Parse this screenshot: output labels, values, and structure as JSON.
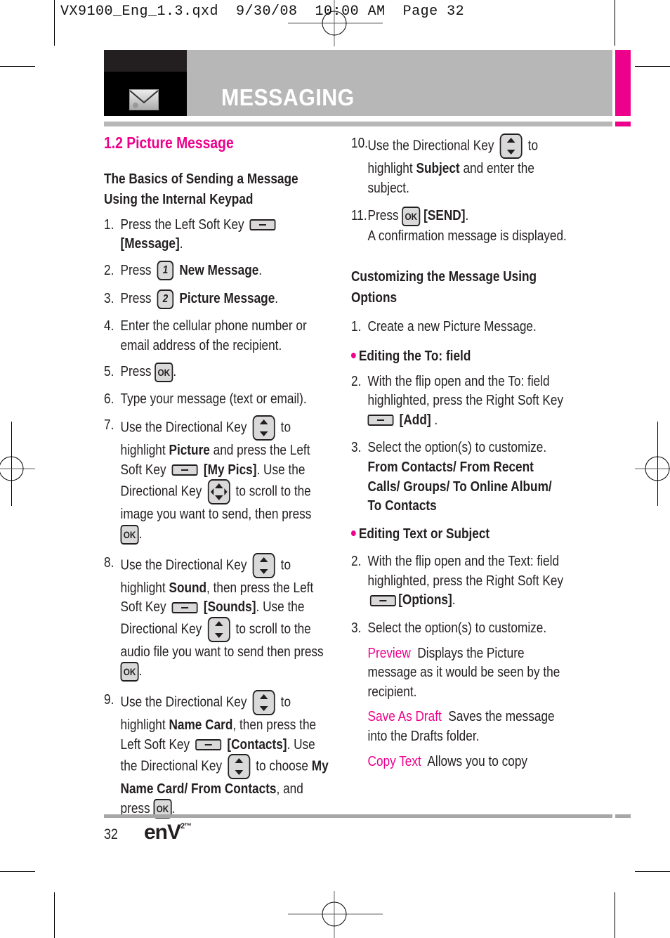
{
  "slug": "VX9100_Eng_1.3.qxd  9/30/08  10:00 AM  Page 32",
  "header": {
    "icon": "envelope-icon",
    "title": "MESSAGING",
    "colors": {
      "accent": "#ec008c",
      "band": "#b8b7b8",
      "dark": "#231f20"
    }
  },
  "section_title": "1.2 Picture Message",
  "left": {
    "heading": "The Basics of Sending a Message Using the Internal Keypad",
    "steps": [
      {
        "num": "1.",
        "parts": [
          "Press the Left Soft Key",
          "[Message]",
          "."
        ]
      },
      {
        "num": "2.",
        "parts": [
          "Press",
          "New Message",
          "."
        ]
      },
      {
        "num": "3.",
        "parts": [
          "Press",
          "Picture Message",
          "."
        ]
      },
      {
        "num": "4.",
        "parts": [
          "Enter the cellular phone number or email address of the recipient."
        ]
      },
      {
        "num": "5.",
        "parts": [
          "Press",
          "."
        ]
      },
      {
        "num": "6.",
        "parts": [
          "Type your message (text or email)."
        ]
      },
      {
        "num": "7.",
        "parts": [
          "Use the Directional Key",
          "to highlight",
          "Picture",
          "and press the Left Soft Key",
          "[My Pics]",
          ". Use the Directional Key",
          "to scroll to the image you want to send, then press",
          "."
        ]
      },
      {
        "num": "8.",
        "parts": [
          "Use the Directional Key",
          "to highlight",
          "Sound",
          ", then press the Left Soft Key",
          "[Sounds]",
          ". Use the Directional Key",
          "to scroll to the audio file you want to send then press",
          "."
        ]
      },
      {
        "num": "9.",
        "parts": [
          "Use the Directional Key",
          "to highlight",
          "Name Card",
          ", then press the Left Soft Key",
          "[Contacts]",
          ". Use the Directional Key",
          "to choose",
          "My Name Card/ From Contacts",
          ", and press",
          "."
        ]
      }
    ],
    "key_labels": {
      "ok": "OK",
      "one": "1",
      "two": "2"
    }
  },
  "right": {
    "steps_top": [
      {
        "num": "10.",
        "parts": [
          "Use the Directional Key",
          "to highlight",
          "Subject",
          "and enter the subject."
        ]
      },
      {
        "num": "11.",
        "parts": [
          "Press",
          "[SEND]",
          ".",
          "A confirmation message is displayed."
        ]
      }
    ],
    "heading": "Customizing the Message Using Options",
    "step1": {
      "num": "1.",
      "text": "Create a new Picture Message."
    },
    "bullet1": "Editing the To: field",
    "step2a": {
      "num": "2.",
      "parts": [
        "With the flip open and the To: field highlighted, press the Right Soft Key",
        "[Add]",
        " ."
      ]
    },
    "step3a": {
      "num": "3.",
      "text": "Select the option(s) to customize.",
      "bold": "From Contacts/ From Recent Calls/ Groups/ To Online Album/ To Contacts"
    },
    "bullet2": "Editing Text or Subject",
    "step2b": {
      "num": "2.",
      "parts": [
        "With the flip open and the Text: field highlighted, press the Right Soft Key",
        "[Options]",
        "."
      ]
    },
    "step3b": {
      "num": "3.",
      "text": "Select the option(s) to customize."
    },
    "options": [
      {
        "name": "Preview",
        "desc": "Displays the Picture message as it would be seen by the recipient."
      },
      {
        "name": "Save As Draft",
        "desc": "Saves the message into the Drafts folder."
      },
      {
        "name": "Copy Text",
        "desc": "Allows you to copy"
      }
    ]
  },
  "footer": {
    "page": "32",
    "logo": "enV",
    "logo_sup": "2™"
  }
}
